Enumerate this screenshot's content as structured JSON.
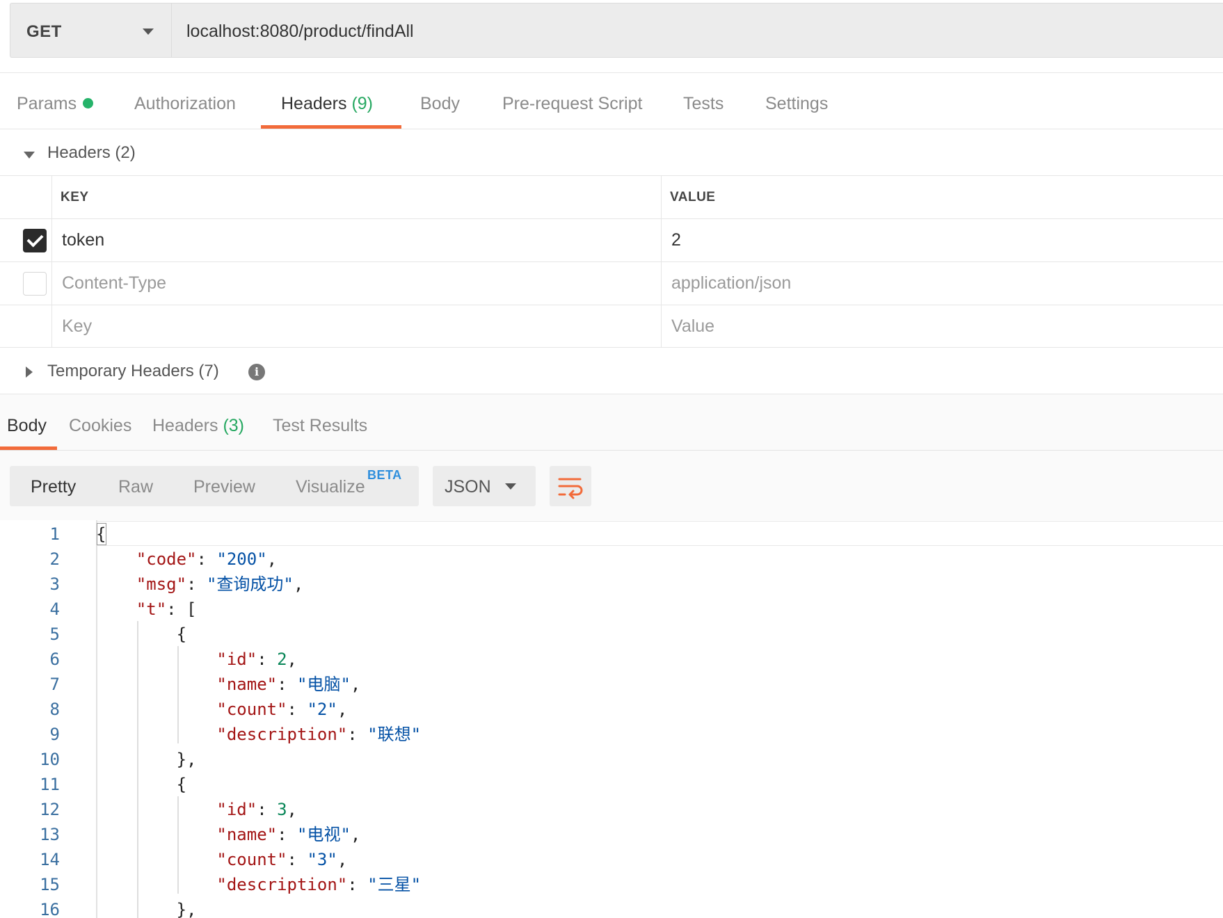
{
  "request": {
    "method": "GET",
    "url": "localhost:8080/product/findAll"
  },
  "request_tabs": [
    {
      "label": "Params",
      "count": ""
    },
    {
      "label": "Authorization",
      "count": ""
    },
    {
      "label": "Headers",
      "count": "(9)"
    },
    {
      "label": "Body",
      "count": ""
    },
    {
      "label": "Pre-request Script",
      "count": ""
    },
    {
      "label": "Tests",
      "count": ""
    },
    {
      "label": "Settings",
      "count": ""
    }
  ],
  "active_request_tab": "Headers",
  "headers_section": {
    "title": "Headers",
    "count": "(2)",
    "columns": {
      "key": "KEY",
      "value": "VALUE"
    },
    "rows": [
      {
        "checked": true,
        "key": "token",
        "value": "2"
      },
      {
        "checked": false,
        "key": "Content-Type",
        "value": "application/json"
      }
    ],
    "placeholder": {
      "key": "Key",
      "value": "Value"
    }
  },
  "temporary_headers": {
    "title": "Temporary Headers",
    "count": "(7)"
  },
  "response_tabs": [
    {
      "label": "Body",
      "count": ""
    },
    {
      "label": "Cookies",
      "count": ""
    },
    {
      "label": "Headers",
      "count": "(3)"
    },
    {
      "label": "Test Results",
      "count": ""
    }
  ],
  "view_modes": [
    "Pretty",
    "Raw",
    "Preview",
    "Visualize"
  ],
  "beta_label": "BETA",
  "active_view_mode": "Pretty",
  "format": "JSON",
  "colors": {
    "accent": "#f26b3a",
    "count_green": "#26a861",
    "key_red": "#a31515",
    "string_blue": "#0451a5",
    "number_green": "#098658"
  },
  "code_lines": [
    {
      "n": "1",
      "tokens": [
        [
          "p",
          "{"
        ]
      ]
    },
    {
      "n": "2",
      "tokens": [
        [
          "p",
          "    "
        ],
        [
          "k",
          "\"code\""
        ],
        [
          "p",
          ": "
        ],
        [
          "s",
          "\"200\""
        ],
        [
          "p",
          ","
        ]
      ]
    },
    {
      "n": "3",
      "tokens": [
        [
          "p",
          "    "
        ],
        [
          "k",
          "\"msg\""
        ],
        [
          "p",
          ": "
        ],
        [
          "s",
          "\"查询成功\""
        ],
        [
          "p",
          ","
        ]
      ]
    },
    {
      "n": "4",
      "tokens": [
        [
          "p",
          "    "
        ],
        [
          "k",
          "\"t\""
        ],
        [
          "p",
          ": ["
        ]
      ]
    },
    {
      "n": "5",
      "tokens": [
        [
          "p",
          "        {"
        ]
      ]
    },
    {
      "n": "6",
      "tokens": [
        [
          "p",
          "            "
        ],
        [
          "k",
          "\"id\""
        ],
        [
          "p",
          ": "
        ],
        [
          "n",
          "2"
        ],
        [
          "p",
          ","
        ]
      ]
    },
    {
      "n": "7",
      "tokens": [
        [
          "p",
          "            "
        ],
        [
          "k",
          "\"name\""
        ],
        [
          "p",
          ": "
        ],
        [
          "s",
          "\"电脑\""
        ],
        [
          "p",
          ","
        ]
      ]
    },
    {
      "n": "8",
      "tokens": [
        [
          "p",
          "            "
        ],
        [
          "k",
          "\"count\""
        ],
        [
          "p",
          ": "
        ],
        [
          "s",
          "\"2\""
        ],
        [
          "p",
          ","
        ]
      ]
    },
    {
      "n": "9",
      "tokens": [
        [
          "p",
          "            "
        ],
        [
          "k",
          "\"description\""
        ],
        [
          "p",
          ": "
        ],
        [
          "s",
          "\"联想\""
        ]
      ]
    },
    {
      "n": "10",
      "tokens": [
        [
          "p",
          "        },"
        ]
      ]
    },
    {
      "n": "11",
      "tokens": [
        [
          "p",
          "        {"
        ]
      ]
    },
    {
      "n": "12",
      "tokens": [
        [
          "p",
          "            "
        ],
        [
          "k",
          "\"id\""
        ],
        [
          "p",
          ": "
        ],
        [
          "n",
          "3"
        ],
        [
          "p",
          ","
        ]
      ]
    },
    {
      "n": "13",
      "tokens": [
        [
          "p",
          "            "
        ],
        [
          "k",
          "\"name\""
        ],
        [
          "p",
          ": "
        ],
        [
          "s",
          "\"电视\""
        ],
        [
          "p",
          ","
        ]
      ]
    },
    {
      "n": "14",
      "tokens": [
        [
          "p",
          "            "
        ],
        [
          "k",
          "\"count\""
        ],
        [
          "p",
          ": "
        ],
        [
          "s",
          "\"3\""
        ],
        [
          "p",
          ","
        ]
      ]
    },
    {
      "n": "15",
      "tokens": [
        [
          "p",
          "            "
        ],
        [
          "k",
          "\"description\""
        ],
        [
          "p",
          ": "
        ],
        [
          "s",
          "\"三星\""
        ]
      ]
    },
    {
      "n": "16",
      "tokens": [
        [
          "p",
          "        },"
        ]
      ]
    }
  ]
}
